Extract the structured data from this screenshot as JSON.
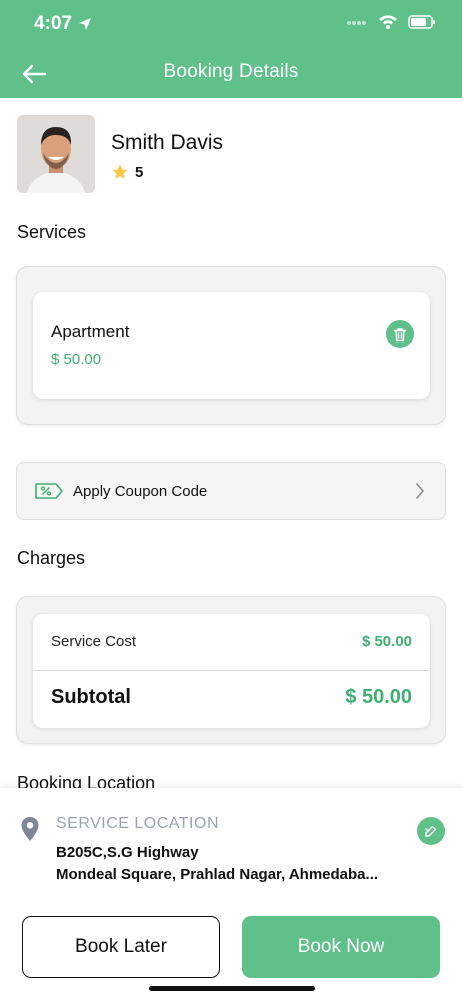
{
  "status_bar": {
    "time": "4:07"
  },
  "header": {
    "title": "Booking Details"
  },
  "provider": {
    "name": "Smith Davis",
    "rating": "5"
  },
  "services": {
    "title": "Services",
    "items": [
      {
        "name": "Apartment",
        "price": "$ 50.00"
      }
    ]
  },
  "coupon": {
    "label": "Apply Coupon Code"
  },
  "charges": {
    "title": "Charges",
    "service_cost_label": "Service Cost",
    "service_cost_value": "$ 50.00",
    "subtotal_label": "Subtotal",
    "subtotal_value": "$ 50.00"
  },
  "booking_location": {
    "title": "Booking Location",
    "label": "SERVICE LOCATION",
    "address_line1": "B205C,S.G Highway",
    "address_line2": "Mondeal Square, Prahlad Nagar, Ahmedaba..."
  },
  "actions": {
    "book_later": "Book Later",
    "book_now": "Book Now"
  },
  "colors": {
    "primary": "#5fc08a",
    "price": "#3fae72",
    "muted": "#9aa3b1"
  },
  "icons": {
    "back": "arrow-left-icon",
    "rating": "star-icon",
    "delete": "trash-icon",
    "coupon": "coupon-tag-icon",
    "chevron": "chevron-right-icon",
    "location": "map-pin-icon",
    "edit": "edit-location-icon"
  }
}
